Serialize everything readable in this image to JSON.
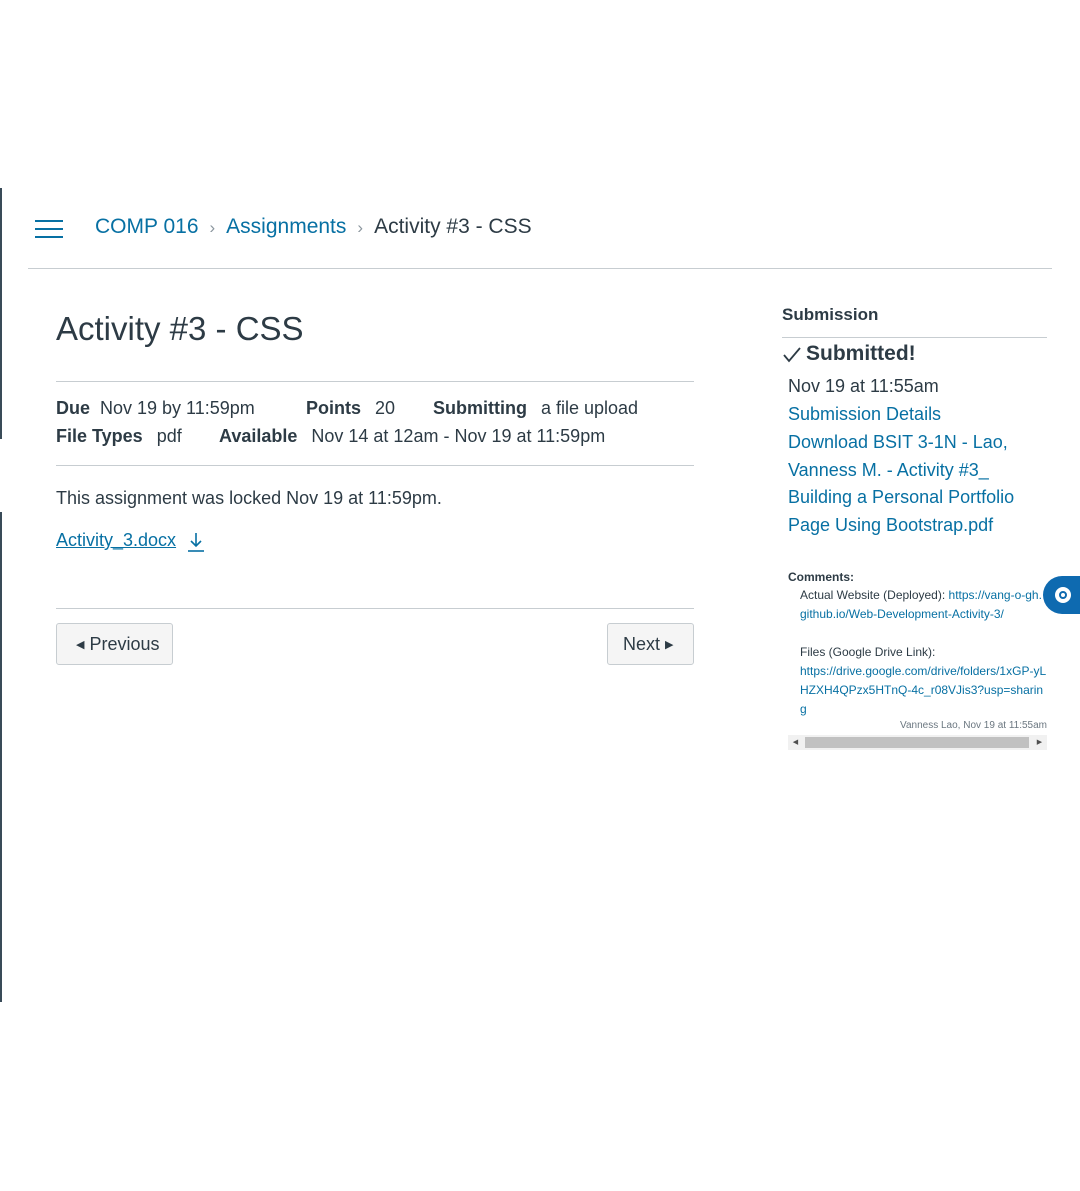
{
  "breadcrumb": {
    "course": "COMP 016",
    "section": "Assignments",
    "current": "Activity #3 - CSS",
    "separator": "›"
  },
  "assignment": {
    "title": "Activity #3 - CSS",
    "due_label": "Due",
    "due_value": "Nov 19 by 11:59pm",
    "points_label": "Points",
    "points_value": "20",
    "submitting_label": "Submitting",
    "submitting_value": "a file upload",
    "filetypes_label": "File Types",
    "filetypes_value": "pdf",
    "available_label": "Available",
    "available_value": "Nov 14 at 12am - Nov 19 at 11:59pm",
    "lock_message": "This assignment was locked Nov 19 at 11:59pm.",
    "attachment": "Activity_3.docx"
  },
  "nav": {
    "previous": "Previous",
    "next": "Next"
  },
  "submission": {
    "heading": "Submission",
    "status": "Submitted!",
    "date": "Nov 19 at 11:55am",
    "details_link": "Submission Details",
    "download_link": "Download BSIT 3-1N - Lao, Vanness M. - Activity #3_ Building a Personal Portfolio Page Using Bootstrap.pdf",
    "comments_label": "Comments:",
    "comment_line1_label": "Actual Website (Deployed):",
    "comment_line1_link": "https://vang-o-gh.github.io/Web-Development-Activity-3/",
    "comment_line2_label": "Files (Google Drive Link):",
    "comment_line2_link": "https://drive.google.com/drive/folders/1xGP-yLHZXH4QPzx5HTnQ-4c_r08VJis3?usp=sharing",
    "comment_meta": "Vanness Lao, Nov 19 at 11:55am"
  },
  "colors": {
    "link": "#0770a3",
    "text": "#2d3b45",
    "accent_button": "#0e6ab0"
  },
  "icons": {
    "menu": "hamburger-icon",
    "download": "download-icon",
    "check": "checkmark-icon",
    "floating": "chat-icon"
  }
}
